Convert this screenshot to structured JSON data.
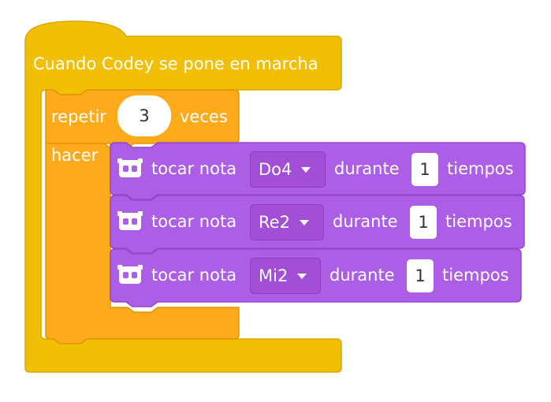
{
  "colors": {
    "event_yellow": "#f1bf05",
    "control_orange": "#fdab1b",
    "sound_purple": "#ad5ee6",
    "dropdown_purple": "#a24ed6",
    "text_white": "#ffffff"
  },
  "hat_block": {
    "label": "Cuando Codey se pone en marcha"
  },
  "repeat_block": {
    "repeat_label": "repetir",
    "count": "3",
    "times_label": "veces",
    "do_label": "hacer"
  },
  "note_blocks": [
    {
      "icon": "codey-robot-icon",
      "label": "tocar nota",
      "note": "Do4",
      "during_label": "durante",
      "beats": "1",
      "beats_label": "tiempos"
    },
    {
      "icon": "codey-robot-icon",
      "label": "tocar nota",
      "note": "Re2",
      "during_label": "durante",
      "beats": "1",
      "beats_label": "tiempos"
    },
    {
      "icon": "codey-robot-icon",
      "label": "tocar nota",
      "note": "Mi2",
      "during_label": "durante",
      "beats": "1",
      "beats_label": "tiempos"
    }
  ]
}
